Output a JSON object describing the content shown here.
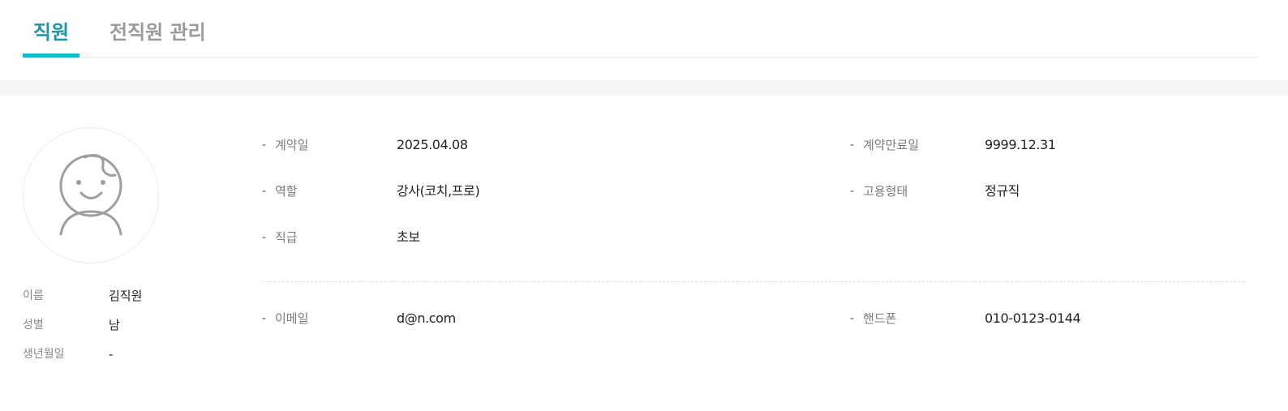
{
  "tabs": [
    {
      "label": "직원",
      "active": true
    },
    {
      "label": "전직원 관리",
      "active": false
    }
  ],
  "colors": {
    "accent": "#1d97a5",
    "tab_indicator": "#18b8d0",
    "inactive_tab": "#9a9a9a"
  },
  "profile": {
    "avatar_icon": "user-face-icon",
    "name_label": "이름",
    "name": "김직원",
    "gender_label": "성별",
    "gender": "남",
    "birthdate_label": "생년월일",
    "birthdate": "-"
  },
  "details": {
    "contract_date": {
      "label": "계약일",
      "value": "2025.04.08"
    },
    "contract_end_date": {
      "label": "계약만료일",
      "value": "9999.12.31"
    },
    "role": {
      "label": "역할",
      "value": "강사(코치,프로)"
    },
    "employment_type": {
      "label": "고용형태",
      "value": "정규직"
    },
    "rank": {
      "label": "직급",
      "value": "초보"
    }
  },
  "contact": {
    "email": {
      "label": "이메일",
      "value": "d@n.com"
    },
    "phone": {
      "label": "핸드폰",
      "value": "010-0123-0144"
    }
  },
  "dash": "-"
}
